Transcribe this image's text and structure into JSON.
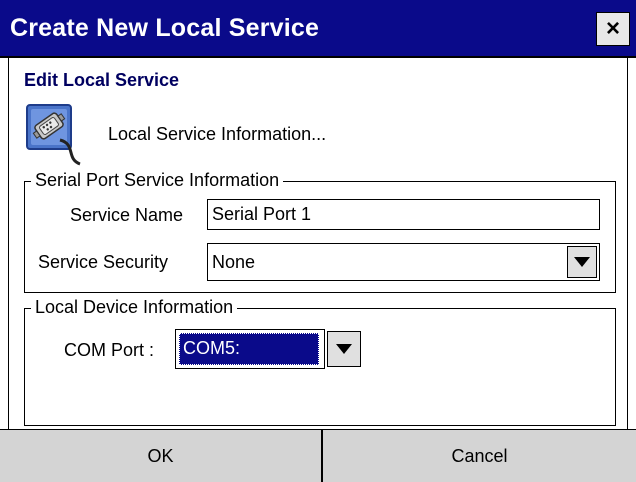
{
  "window": {
    "title": "Create New Local Service",
    "close_label": "×"
  },
  "subtitle": "Edit Local Service",
  "info": {
    "icon": "serial-connector-icon",
    "label": "Local Service Information..."
  },
  "serial_group": {
    "legend": "Serial Port Service Information",
    "service_name_label": "Service Name",
    "service_name_value": "Serial Port 1",
    "service_security_label": "Service Security",
    "service_security_value": "None"
  },
  "device_group": {
    "legend": "Local Device Information",
    "com_port_label": "COM Port :",
    "com_port_value": "COM5:"
  },
  "buttons": {
    "ok": "OK",
    "cancel": "Cancel"
  },
  "colors": {
    "title_bar": "#0a0a8a",
    "selection": "#0a0a8a",
    "button_bar": "#d4d4d4"
  }
}
